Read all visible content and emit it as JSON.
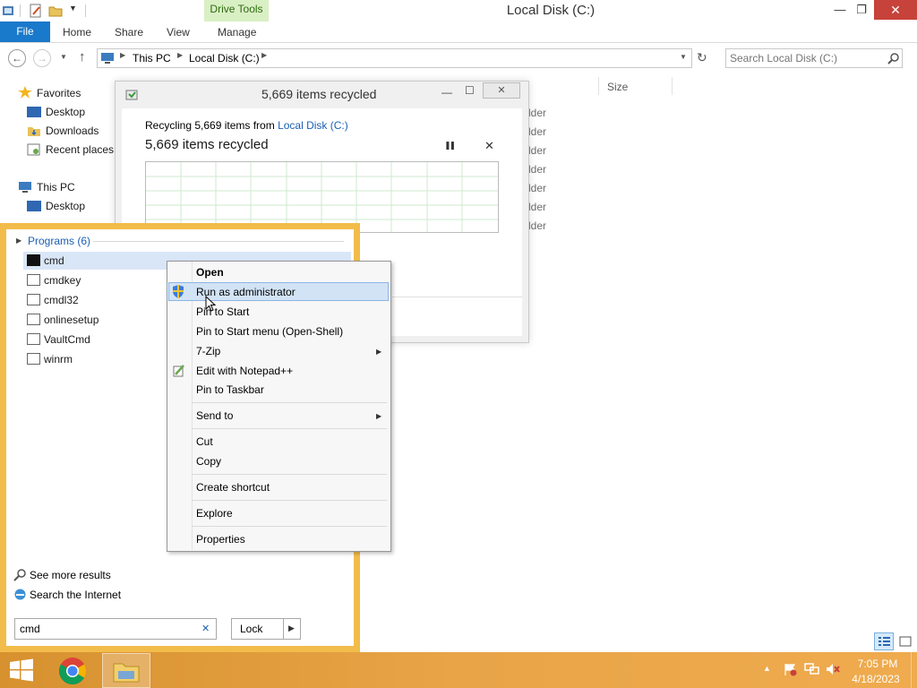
{
  "window": {
    "title": "Local Disk (C:)",
    "contextual_tab": "Drive Tools",
    "minimize_glyph": "—",
    "restore_glyph": "❐",
    "close_glyph": "✕"
  },
  "ribbon": {
    "tabs": [
      "File",
      "Home",
      "Share",
      "View",
      "Manage"
    ]
  },
  "address": {
    "path": [
      "This PC",
      "Local Disk (C:)"
    ],
    "search_placeholder": "Search Local Disk (C:)"
  },
  "nav_pane": {
    "favorites": "Favorites",
    "desktop": "Desktop",
    "downloads": "Downloads",
    "recent_places": "Recent places",
    "this_pc": "This PC",
    "pc_desktop": "Desktop"
  },
  "file_list": {
    "column_size": "Size",
    "type_fragment": "lder"
  },
  "progress_dialog": {
    "title": "5,669 items recycled",
    "status_prefix": "Recycling 5,669 items from ",
    "status_link": "Local Disk (C:)",
    "heading": "5,669 items recycled",
    "pause_glyph": "❚❚",
    "cancel_glyph": "✕"
  },
  "start_search": {
    "group_label": "Programs (6)",
    "programs": [
      "cmd",
      "cmdkey",
      "cmdl32",
      "onlinesetup",
      "VaultCmd",
      "winrm"
    ],
    "see_more": "See more results",
    "search_internet": "Search the Internet",
    "query": "cmd",
    "clear_glyph": "✕",
    "lock_label": "Lock"
  },
  "context_menu": {
    "open": "Open",
    "run_as_admin": "Run as administrator",
    "pin_to_start": "Pin to Start",
    "pin_to_start_menu": "Pin to Start menu (Open-Shell)",
    "seven_zip": "7-Zip",
    "edit_notepad": "Edit with Notepad++",
    "pin_taskbar": "Pin to Taskbar",
    "send_to": "Send to",
    "cut": "Cut",
    "copy": "Copy",
    "create_shortcut": "Create shortcut",
    "explore": "Explore",
    "properties": "Properties"
  },
  "taskbar": {
    "time": "7:05 PM",
    "date": "4/18/2023",
    "pinned": [
      "start-icon",
      "chrome-icon",
      "file-explorer-icon"
    ]
  },
  "colors": {
    "accent_blue": "#1979ca",
    "start_panel": "#f2bc4a",
    "taskbar": "#e8a447",
    "close_red": "#c7423a"
  }
}
